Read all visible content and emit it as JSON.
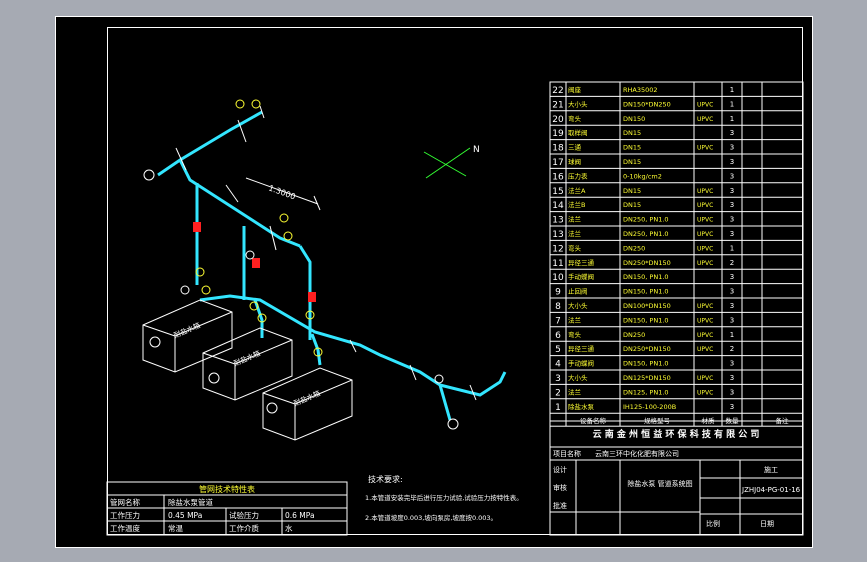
{
  "compass": {
    "north": "N"
  },
  "dimension_label": "1.3000",
  "tank_label": "耐盐水箱",
  "bom": {
    "rows": [
      {
        "no": "22",
        "name": "阀座",
        "spec": "RHA35002",
        "mat": "",
        "qty": "1"
      },
      {
        "no": "21",
        "name": "大小头",
        "spec": "DN150*DN250",
        "mat": "UPVC",
        "qty": "1"
      },
      {
        "no": "20",
        "name": "弯头",
        "spec": "DN150",
        "mat": "UPVC",
        "qty": "1"
      },
      {
        "no": "19",
        "name": "取样阀",
        "spec": "DN15",
        "mat": "",
        "qty": "3"
      },
      {
        "no": "18",
        "name": "三通",
        "spec": "DN15",
        "mat": "UPVC",
        "qty": "3"
      },
      {
        "no": "17",
        "name": "球阀",
        "spec": "DN15",
        "mat": "",
        "qty": "3"
      },
      {
        "no": "16",
        "name": "压力表",
        "spec": "0-10kg/cm2",
        "mat": "",
        "qty": "3"
      },
      {
        "no": "15",
        "name": "法兰A",
        "spec": "DN15",
        "mat": "UPVC",
        "qty": "3"
      },
      {
        "no": "14",
        "name": "法兰B",
        "spec": "DN15",
        "mat": "UPVC",
        "qty": "3"
      },
      {
        "no": "13",
        "name": "法兰",
        "spec": "DN250, PN1.0",
        "mat": "UPVC",
        "qty": "3"
      },
      {
        "no": "13",
        "name": "法兰",
        "spec": "DN250, PN1.0",
        "mat": "UPVC",
        "qty": "3"
      },
      {
        "no": "12",
        "name": "弯头",
        "spec": "DN250",
        "mat": "UPVC",
        "qty": "1"
      },
      {
        "no": "11",
        "name": "异径三通",
        "spec": "DN250*DN150",
        "mat": "UPVC",
        "qty": "2"
      },
      {
        "no": "10",
        "name": "手动蝶阀",
        "spec": "DN150, PN1.0",
        "mat": "",
        "qty": "3"
      },
      {
        "no": "9",
        "name": "止回阀",
        "spec": "DN150, PN1.0",
        "mat": "",
        "qty": "3"
      },
      {
        "no": "8",
        "name": "大小头",
        "spec": "DN100*DN150",
        "mat": "UPVC",
        "qty": "3"
      },
      {
        "no": "7",
        "name": "法兰",
        "spec": "DN150, PN1.0",
        "mat": "UPVC",
        "qty": "3"
      },
      {
        "no": "6",
        "name": "弯头",
        "spec": "DN250",
        "mat": "UPVC",
        "qty": "1"
      },
      {
        "no": "5",
        "name": "异径三通",
        "spec": "DN250*DN150",
        "mat": "UPVC",
        "qty": "2"
      },
      {
        "no": "4",
        "name": "手动蝶阀",
        "spec": "DN150, PN1.0",
        "mat": "",
        "qty": "3"
      },
      {
        "no": "3",
        "name": "大小头",
        "spec": "DN125*DN150",
        "mat": "UPVC",
        "qty": "3"
      },
      {
        "no": "2",
        "name": "法兰",
        "spec": "DN125, PN1.0",
        "mat": "UPVC",
        "qty": "3"
      },
      {
        "no": "1",
        "name": "除盐水泵",
        "spec": "IH125-100-200B",
        "mat": "",
        "qty": "3"
      }
    ],
    "header": {
      "name": "设备名称",
      "spec": "规格型号",
      "mat": "材质",
      "qty": "数量",
      "note": "备注"
    }
  },
  "title_block": {
    "company": "云 南 金 州 恒 益 环 保 科 技 有 限 公 司",
    "project_label": "项目名称",
    "project": "云南三环中化化肥有限公司",
    "drawing_name": "除盐水泵\n管道系统图",
    "stage": "施工",
    "drawing_no": "JZHJ04-PG-01-16",
    "design": "设计",
    "check": "审核",
    "approve": "批准",
    "scale": "比例",
    "date": "日期"
  },
  "pipe_table": {
    "title": "管网技术特性表",
    "rows": [
      [
        "管网名称",
        "除盐水泵管道",
        "",
        ""
      ],
      [
        "工作压力",
        "0.45 MPa",
        "试验压力",
        "0.6 MPa"
      ],
      [
        "工作温度",
        "常温",
        "工作介质",
        "水"
      ]
    ]
  },
  "notes": {
    "title": "技术要求:",
    "items": [
      "1.本管道安装完毕后进行压力试验,试验压力按特性表。",
      "2.本管道坡度0.003,坡向泵房,坡度按0.003。"
    ]
  }
}
